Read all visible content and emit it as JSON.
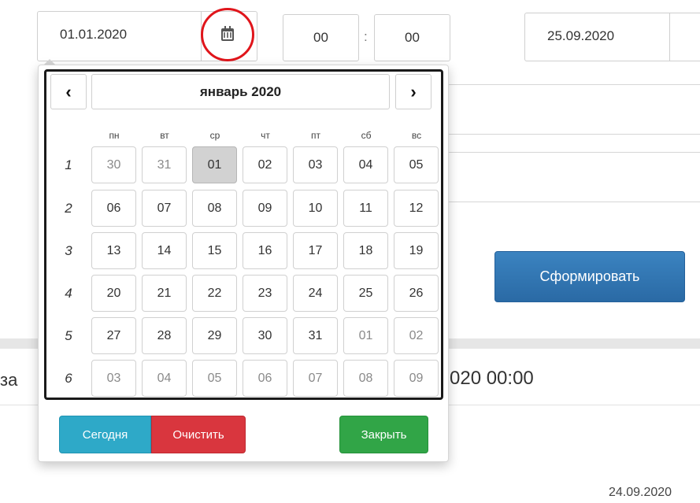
{
  "form": {
    "date_from": "01.01.2020",
    "hour": "00",
    "time_separator": ":",
    "minute": "00",
    "date_to": "25.09.2020"
  },
  "calendar": {
    "prev": "‹",
    "next": "›",
    "month_title": "январь 2020",
    "weekdays": [
      "пн",
      "вт",
      "ср",
      "чт",
      "пт",
      "сб",
      "вс"
    ],
    "weeks": [
      {
        "num": "1",
        "days": [
          "30",
          "31",
          "01",
          "02",
          "03",
          "04",
          "05"
        ]
      },
      {
        "num": "2",
        "days": [
          "06",
          "07",
          "08",
          "09",
          "10",
          "11",
          "12"
        ]
      },
      {
        "num": "3",
        "days": [
          "13",
          "14",
          "15",
          "16",
          "17",
          "18",
          "19"
        ]
      },
      {
        "num": "4",
        "days": [
          "20",
          "21",
          "22",
          "23",
          "24",
          "25",
          "26"
        ]
      },
      {
        "num": "5",
        "days": [
          "27",
          "28",
          "29",
          "30",
          "31",
          "01",
          "02"
        ]
      },
      {
        "num": "6",
        "days": [
          "03",
          "04",
          "05",
          "06",
          "07",
          "08",
          "09"
        ]
      }
    ],
    "today_label": "Сегодня",
    "clear_label": "Очистить",
    "close_label": "Закрыть"
  },
  "main": {
    "generate_label": "Сформировать",
    "title_left": "за",
    "title_right": "020 00:00",
    "row_date": "24.09.2020"
  },
  "colors": {
    "highlight_circle": "#e0151b",
    "generate_button": "#2f75b5",
    "today_button": "#2ea9c8",
    "clear_button": "#d9363e",
    "close_button": "#31a547",
    "selected_day": "#d2d2d2"
  },
  "icons": {
    "calendar": "calendar-icon"
  }
}
